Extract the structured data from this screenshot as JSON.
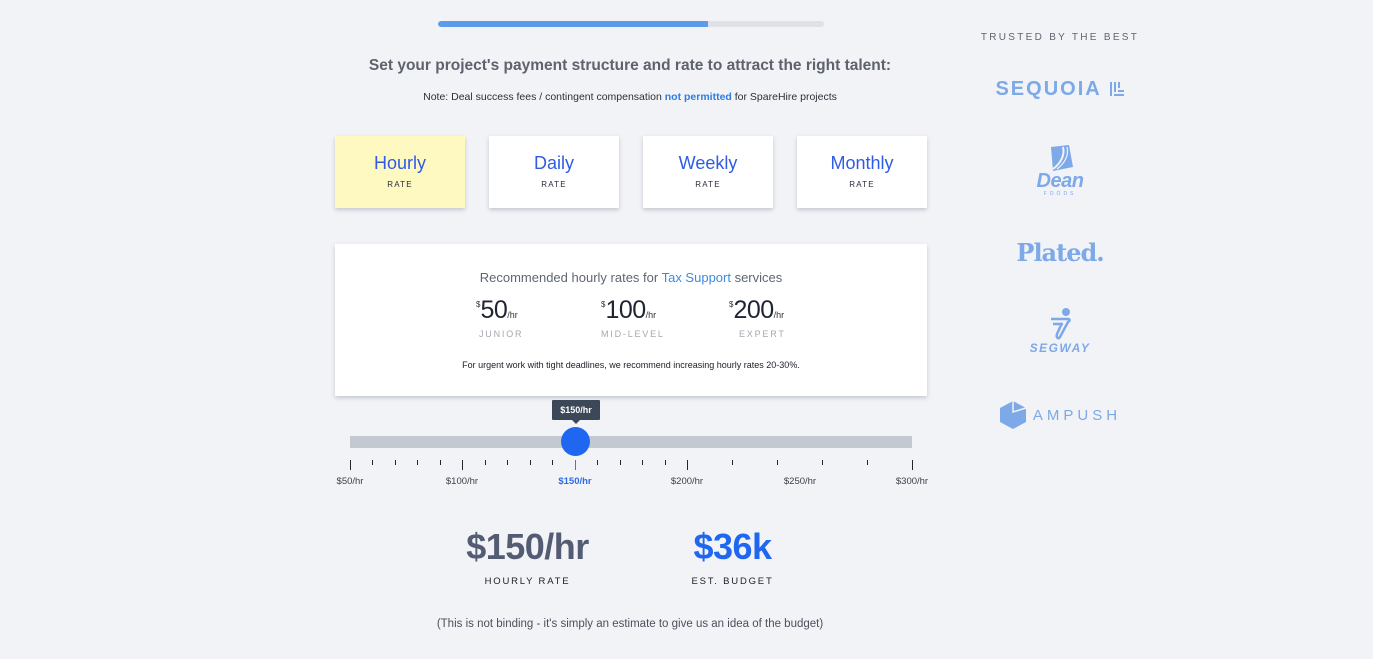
{
  "progress": {
    "percent": 70,
    "fill_color": "#5b9be9"
  },
  "header": {
    "headline": "Set your project's payment structure and rate to attract the right talent:",
    "note_prefix": "Note: Deal success fees / contingent compensation ",
    "note_highlight": "not permitted",
    "note_suffix": " for SpareHire projects"
  },
  "rate_types": [
    {
      "label": "Hourly",
      "sub": "RATE",
      "selected": true
    },
    {
      "label": "Daily",
      "sub": "RATE",
      "selected": false
    },
    {
      "label": "Weekly",
      "sub": "RATE",
      "selected": false
    },
    {
      "label": "Monthly",
      "sub": "RATE",
      "selected": false
    }
  ],
  "recommendation": {
    "title_prefix": "Recommended hourly rates for ",
    "service": "Tax Support",
    "title_suffix": " services",
    "tiers": [
      {
        "currency": "$",
        "amount": "50",
        "unit": "/hr",
        "level": "JUNIOR"
      },
      {
        "currency": "$",
        "amount": "100",
        "unit": "/hr",
        "level": "MID-LEVEL"
      },
      {
        "currency": "$",
        "amount": "200",
        "unit": "/hr",
        "level": "EXPERT"
      }
    ],
    "urgent_note": "For urgent work with tight deadlines, we recommend increasing hourly rates 20-30%."
  },
  "slider": {
    "min": 50,
    "max": 300,
    "value": 150,
    "tooltip": "$150/hr",
    "ticks": [
      50,
      60,
      70,
      80,
      90,
      100,
      110,
      120,
      130,
      140,
      150,
      160,
      170,
      180,
      190,
      200,
      220,
      240,
      260,
      280,
      300
    ],
    "major_ticks": [
      50,
      100,
      150,
      200,
      300
    ],
    "labels": [
      {
        "value": 50,
        "text": "$50/hr"
      },
      {
        "value": 100,
        "text": "$100/hr"
      },
      {
        "value": 150,
        "text": "$150/hr"
      },
      {
        "value": 200,
        "text": "$200/hr"
      },
      {
        "value": 250,
        "text": "$250/hr"
      },
      {
        "value": 300,
        "text": "$300/hr"
      }
    ]
  },
  "summary": {
    "rate_value": "$150/hr",
    "rate_caption": "HOURLY RATE",
    "budget_value": "$36k",
    "budget_caption": "EST. BUDGET",
    "disclaimer": "(This is not binding - it's simply an estimate to give us an idea of the budget)"
  },
  "sidebar": {
    "trusted_label": "TRUSTED BY THE BEST",
    "logos": {
      "sequoia": "SEQUOIA",
      "dean": "Dean",
      "dean_sub": "FOODS",
      "plated": "Plated.",
      "segway": "SEGWAY",
      "ampush": "AMPUSH"
    }
  }
}
